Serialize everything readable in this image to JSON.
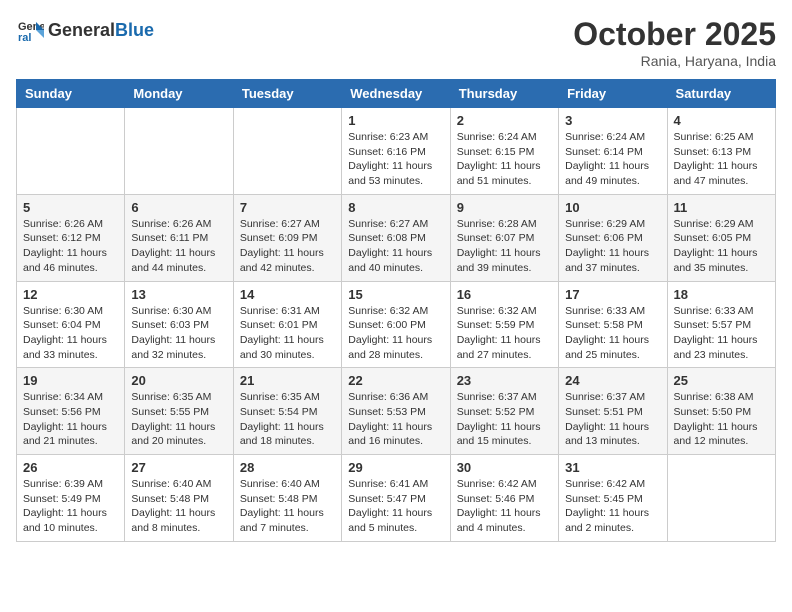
{
  "header": {
    "logo_general": "General",
    "logo_blue": "Blue",
    "month": "October 2025",
    "location": "Rania, Haryana, India"
  },
  "days_of_week": [
    "Sunday",
    "Monday",
    "Tuesday",
    "Wednesday",
    "Thursday",
    "Friday",
    "Saturday"
  ],
  "weeks": [
    [
      {
        "day": "",
        "info": ""
      },
      {
        "day": "",
        "info": ""
      },
      {
        "day": "",
        "info": ""
      },
      {
        "day": "1",
        "info": "Sunrise: 6:23 AM\nSunset: 6:16 PM\nDaylight: 11 hours and 53 minutes."
      },
      {
        "day": "2",
        "info": "Sunrise: 6:24 AM\nSunset: 6:15 PM\nDaylight: 11 hours and 51 minutes."
      },
      {
        "day": "3",
        "info": "Sunrise: 6:24 AM\nSunset: 6:14 PM\nDaylight: 11 hours and 49 minutes."
      },
      {
        "day": "4",
        "info": "Sunrise: 6:25 AM\nSunset: 6:13 PM\nDaylight: 11 hours and 47 minutes."
      }
    ],
    [
      {
        "day": "5",
        "info": "Sunrise: 6:26 AM\nSunset: 6:12 PM\nDaylight: 11 hours and 46 minutes."
      },
      {
        "day": "6",
        "info": "Sunrise: 6:26 AM\nSunset: 6:11 PM\nDaylight: 11 hours and 44 minutes."
      },
      {
        "day": "7",
        "info": "Sunrise: 6:27 AM\nSunset: 6:09 PM\nDaylight: 11 hours and 42 minutes."
      },
      {
        "day": "8",
        "info": "Sunrise: 6:27 AM\nSunset: 6:08 PM\nDaylight: 11 hours and 40 minutes."
      },
      {
        "day": "9",
        "info": "Sunrise: 6:28 AM\nSunset: 6:07 PM\nDaylight: 11 hours and 39 minutes."
      },
      {
        "day": "10",
        "info": "Sunrise: 6:29 AM\nSunset: 6:06 PM\nDaylight: 11 hours and 37 minutes."
      },
      {
        "day": "11",
        "info": "Sunrise: 6:29 AM\nSunset: 6:05 PM\nDaylight: 11 hours and 35 minutes."
      }
    ],
    [
      {
        "day": "12",
        "info": "Sunrise: 6:30 AM\nSunset: 6:04 PM\nDaylight: 11 hours and 33 minutes."
      },
      {
        "day": "13",
        "info": "Sunrise: 6:30 AM\nSunset: 6:03 PM\nDaylight: 11 hours and 32 minutes."
      },
      {
        "day": "14",
        "info": "Sunrise: 6:31 AM\nSunset: 6:01 PM\nDaylight: 11 hours and 30 minutes."
      },
      {
        "day": "15",
        "info": "Sunrise: 6:32 AM\nSunset: 6:00 PM\nDaylight: 11 hours and 28 minutes."
      },
      {
        "day": "16",
        "info": "Sunrise: 6:32 AM\nSunset: 5:59 PM\nDaylight: 11 hours and 27 minutes."
      },
      {
        "day": "17",
        "info": "Sunrise: 6:33 AM\nSunset: 5:58 PM\nDaylight: 11 hours and 25 minutes."
      },
      {
        "day": "18",
        "info": "Sunrise: 6:33 AM\nSunset: 5:57 PM\nDaylight: 11 hours and 23 minutes."
      }
    ],
    [
      {
        "day": "19",
        "info": "Sunrise: 6:34 AM\nSunset: 5:56 PM\nDaylight: 11 hours and 21 minutes."
      },
      {
        "day": "20",
        "info": "Sunrise: 6:35 AM\nSunset: 5:55 PM\nDaylight: 11 hours and 20 minutes."
      },
      {
        "day": "21",
        "info": "Sunrise: 6:35 AM\nSunset: 5:54 PM\nDaylight: 11 hours and 18 minutes."
      },
      {
        "day": "22",
        "info": "Sunrise: 6:36 AM\nSunset: 5:53 PM\nDaylight: 11 hours and 16 minutes."
      },
      {
        "day": "23",
        "info": "Sunrise: 6:37 AM\nSunset: 5:52 PM\nDaylight: 11 hours and 15 minutes."
      },
      {
        "day": "24",
        "info": "Sunrise: 6:37 AM\nSunset: 5:51 PM\nDaylight: 11 hours and 13 minutes."
      },
      {
        "day": "25",
        "info": "Sunrise: 6:38 AM\nSunset: 5:50 PM\nDaylight: 11 hours and 12 minutes."
      }
    ],
    [
      {
        "day": "26",
        "info": "Sunrise: 6:39 AM\nSunset: 5:49 PM\nDaylight: 11 hours and 10 minutes."
      },
      {
        "day": "27",
        "info": "Sunrise: 6:40 AM\nSunset: 5:48 PM\nDaylight: 11 hours and 8 minutes."
      },
      {
        "day": "28",
        "info": "Sunrise: 6:40 AM\nSunset: 5:48 PM\nDaylight: 11 hours and 7 minutes."
      },
      {
        "day": "29",
        "info": "Sunrise: 6:41 AM\nSunset: 5:47 PM\nDaylight: 11 hours and 5 minutes."
      },
      {
        "day": "30",
        "info": "Sunrise: 6:42 AM\nSunset: 5:46 PM\nDaylight: 11 hours and 4 minutes."
      },
      {
        "day": "31",
        "info": "Sunrise: 6:42 AM\nSunset: 5:45 PM\nDaylight: 11 hours and 2 minutes."
      },
      {
        "day": "",
        "info": ""
      }
    ]
  ]
}
